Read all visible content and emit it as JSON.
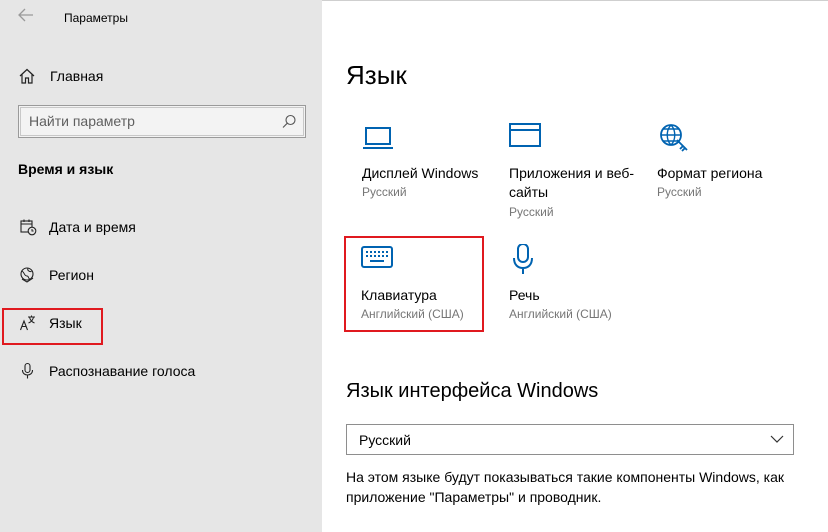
{
  "window": {
    "title": "Параметры"
  },
  "sidebar": {
    "home_label": "Главная",
    "search_placeholder": "Найти параметр",
    "section_title": "Время и язык",
    "items": [
      {
        "label": "Дата и время",
        "icon": "calendar-clock-icon"
      },
      {
        "label": "Регион",
        "icon": "globe-icon"
      },
      {
        "label": "Язык",
        "icon": "language-icon",
        "selected": true
      },
      {
        "label": "Распознавание голоса",
        "icon": "microphone-icon"
      }
    ]
  },
  "main": {
    "title": "Язык",
    "tiles": [
      {
        "title": "Дисплей Windows",
        "subtitle": "Русский",
        "icon": "display-icon"
      },
      {
        "title": "Приложения и веб-сайты",
        "subtitle": "Русский",
        "icon": "window-icon"
      },
      {
        "title": "Формат региона",
        "subtitle": "Русский",
        "icon": "region-format-icon"
      },
      {
        "title": "Клавиатура",
        "subtitle": "Английский (США)",
        "icon": "keyboard-icon"
      },
      {
        "title": "Речь",
        "subtitle": "Английский (США)",
        "icon": "microphone-icon"
      }
    ],
    "interface_section_title": "Язык интерфейса Windows",
    "interface_language": "Русский",
    "interface_description": "На этом языке будут показываться такие компоненты Windows, как приложение \"Параметры\" и проводник."
  },
  "colors": {
    "accent": "#0063b1",
    "highlight": "#e0191f",
    "sidebar_bg": "#e6e6e6"
  }
}
